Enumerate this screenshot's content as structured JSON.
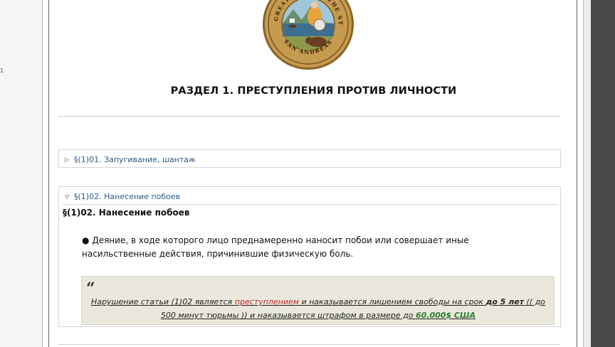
{
  "gutter": {
    "line_number": "1"
  },
  "seal": {
    "top_text": "THE GREAT SEAL OF THE STATE",
    "bottom_text": "SAN ANDREAS"
  },
  "section": {
    "title": "РАЗДЕЛ 1. ПРЕСТУПЛЕНИЯ ПРОТИВ ЛИЧНОСТИ"
  },
  "articles": [
    {
      "summary": "§(1)01. Запугивание, шантаж",
      "expanded": false
    },
    {
      "summary": "§(1)02. Нанесение побоев",
      "expanded": true,
      "heading": "§(1)02. Нанесение побоев",
      "bullet": "●",
      "text": "Деяние, в ходе которого лицо преднамеренно наносит побои или совершает иные насильственные действия, причинившие физическую боль.",
      "quote": {
        "mark": "“",
        "part1": "Нарушение статьи (1)02 является ",
        "crime": "преступлением",
        "part2": " и наказывается лишением свободы на срок ",
        "term": "до 5 лет",
        "part3": " (( до 500 минут тюрьмы )) и наказывается штрафом в размере до ",
        "fine": "60.000$ США"
      }
    }
  ],
  "colors": {
    "link": "#2a5b86",
    "crime": "#c0262d",
    "fine": "#2e7d2e",
    "quote_bg": "#eae8dc",
    "scrollbar": "#4a4a4a"
  }
}
